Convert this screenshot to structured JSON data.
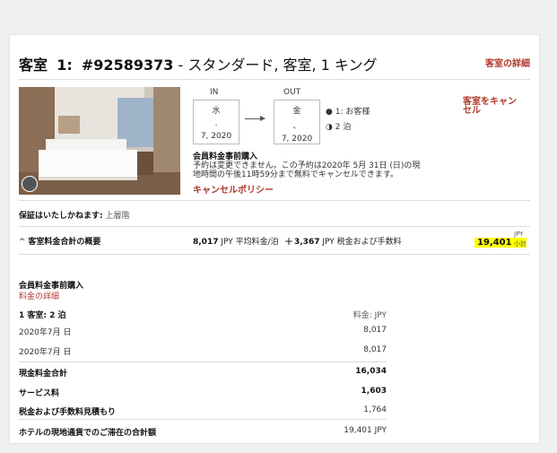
{
  "room": {
    "title_prefix": "客室",
    "title_index": "1:",
    "confirmation": "#92589373",
    "title_suffix": "- スタンダード, 客室, 1 キング",
    "detail_link": "客室の詳細",
    "cancel_link": "客室をキャンセル"
  },
  "dates": {
    "in_label": "IN",
    "in_day": "水",
    "in_dot": ".",
    "in_year": "7, 2020",
    "out_label": "OUT",
    "out_day": "金",
    "out_dot": "、",
    "out_year": "7, 2020"
  },
  "guests": {
    "guests_text": "1: お客様",
    "nights_text": "2 泊"
  },
  "rate": {
    "name": "会員料金事前購入",
    "policy_text_1": "予約は変更できません。この予約は2020年 5月 31日 (日)の現",
    "policy_text_2": "地時間の午後11時59分まで無料でキャンセルできます。",
    "policy_link": "キャンセルポリシー"
  },
  "guarantee": {
    "label": "保証はいたしかねます:",
    "value": "上層階"
  },
  "summary": {
    "label": "客室料金合計の概要",
    "avg_amount": "8,017",
    "avg_text": "JPY 平均料金/泊",
    "plus": "+",
    "tax_amount": "3,367",
    "tax_text": "JPY 税金および手数料",
    "total_amount": "19,401",
    "total_currency": "JPY",
    "total_note": "小計"
  },
  "details": {
    "rate_name": "会員料金事前購入",
    "rate_link": "料金の詳細",
    "room_nights": "1 客室: 2 泊",
    "rate_header": "料金: JPY",
    "nights": [
      {
        "date": "2020年7月  日",
        "amount": "8,017"
      },
      {
        "date": "2020年7月  日",
        "amount": "8,017"
      }
    ],
    "cash_total_label": "現金料金合計",
    "cash_total": "16,034",
    "service_label": "サービス料",
    "service": "1,603",
    "tax_label": "税金および手数料見積もり",
    "tax": "1,764",
    "grand_label": "ホテルの現地通貨でのご滞在の合計額",
    "grand_total": "19,401 JPY"
  }
}
